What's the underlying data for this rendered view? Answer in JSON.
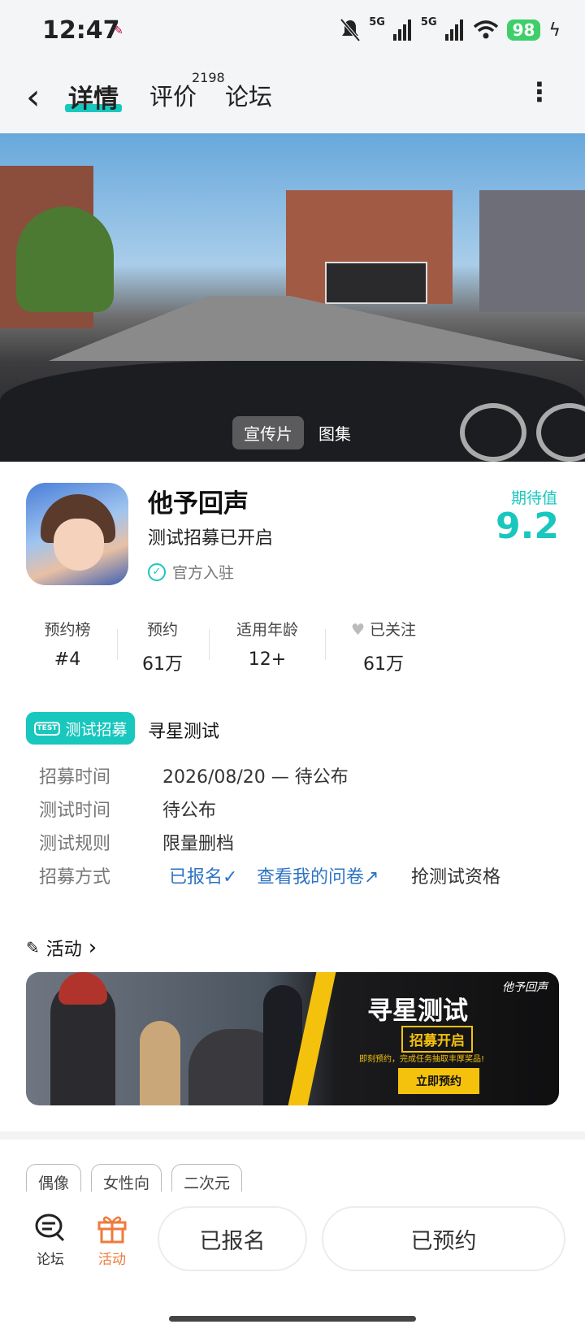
{
  "status_bar": {
    "time": "12:47",
    "battery": "98",
    "signal_1": "5G",
    "signal_2": "5G"
  },
  "nav": {
    "tabs": [
      {
        "label": "详情",
        "active": true
      },
      {
        "label": "评价",
        "count": "2198"
      },
      {
        "label": "论坛"
      }
    ]
  },
  "media": {
    "tabs": [
      "宣传片",
      "图集"
    ]
  },
  "app": {
    "name": "他予回声",
    "status": "测试招募已开启",
    "official": "官方入驻",
    "expect_label": "期待值",
    "expect_value": "9.2"
  },
  "stats": [
    {
      "label": "预约榜",
      "value": "#4"
    },
    {
      "label": "预约",
      "value": "61万"
    },
    {
      "label": "适用年龄",
      "value": "12+"
    },
    {
      "label": "已关注",
      "value": "61万"
    }
  ],
  "recruit": {
    "tag": "测试招募",
    "tag_icon_text": "TEST",
    "title": "寻星测试",
    "rows": [
      {
        "label": "招募时间",
        "value": "2026/08/20 — 待公布"
      },
      {
        "label": "测试时间",
        "value": "待公布"
      },
      {
        "label": "测试规则",
        "value": "限量删档"
      }
    ],
    "method_label": "招募方式",
    "method_signed": "已报名",
    "method_survey": "查看我的问卷",
    "method_grab": "抢测试资格"
  },
  "activity": {
    "title": "活动",
    "banner": {
      "logo": "他予回声",
      "headline": "寻星测试",
      "sub": "招募开启",
      "desc": "即刻预约，完成任务抽取丰厚奖品!",
      "cta": "立即预约"
    }
  },
  "tags": [
    "偶像",
    "女性向",
    "二次元"
  ],
  "bottom": {
    "forum": "论坛",
    "activity": "活动",
    "signed_button": "已报名",
    "reserved_button": "已预约"
  },
  "colors": {
    "accent": "#18c7bd",
    "link": "#2d74c4",
    "activity_icon": "#f07a3c"
  }
}
